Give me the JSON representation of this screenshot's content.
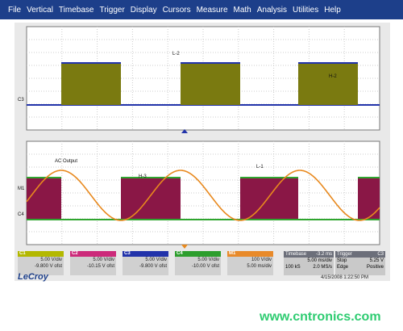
{
  "menu": [
    "File",
    "Vertical",
    "Timebase",
    "Trigger",
    "Display",
    "Cursors",
    "Measure",
    "Math",
    "Analysis",
    "Utilities",
    "Help"
  ],
  "traces": {
    "top_label_l2": "L-2",
    "top_label_h2": "H-2",
    "ac_output": "AC Output",
    "h3": "H-3",
    "l1": "L-1",
    "c3": "C3",
    "m1": "M1",
    "c4": "C4"
  },
  "channels": [
    {
      "name": "C1",
      "color": "#b3b800",
      "vdiv": "5.00 V/div",
      "ofst": "-9.800 V ofst"
    },
    {
      "name": "C2",
      "color": "#cc2a7a",
      "vdiv": "5.00 V/div",
      "ofst": "-10.15 V ofst"
    },
    {
      "name": "C3",
      "color": "#2233aa",
      "vdiv": "5.00 V/div",
      "ofst": "-9.800 V ofst"
    },
    {
      "name": "C4",
      "color": "#2d9e2d",
      "vdiv": "5.00 V/div",
      "ofst": "-10.00 V ofst"
    },
    {
      "name": "M1",
      "color": "#e88a2a",
      "vdiv": "100 V/div",
      "ofst": "5.00 ms/div"
    }
  ],
  "timebase": {
    "label": "Timebase",
    "value": "-3.2 ms",
    "row2a": "",
    "row2b": "5.00 ms/div",
    "row3a": "100 kS",
    "row3b": "2.0 MS/s"
  },
  "trigger": {
    "label": "Trigger",
    "badge": "C3",
    "row2a": "Stop",
    "row2b": "5.25 V",
    "row3a": "Edge",
    "row3b": "Positive"
  },
  "brand": "LeCroy",
  "datetime": "4/15/2008 1:22:50 PM",
  "watermark": "www.cntronics.com",
  "colors": {
    "menubar": "#1d3f8a",
    "olive": "#7a7a10",
    "maroon": "#8a1746",
    "orange": "#e8891e",
    "green": "#2fa52f",
    "blue": "#2233aa"
  }
}
